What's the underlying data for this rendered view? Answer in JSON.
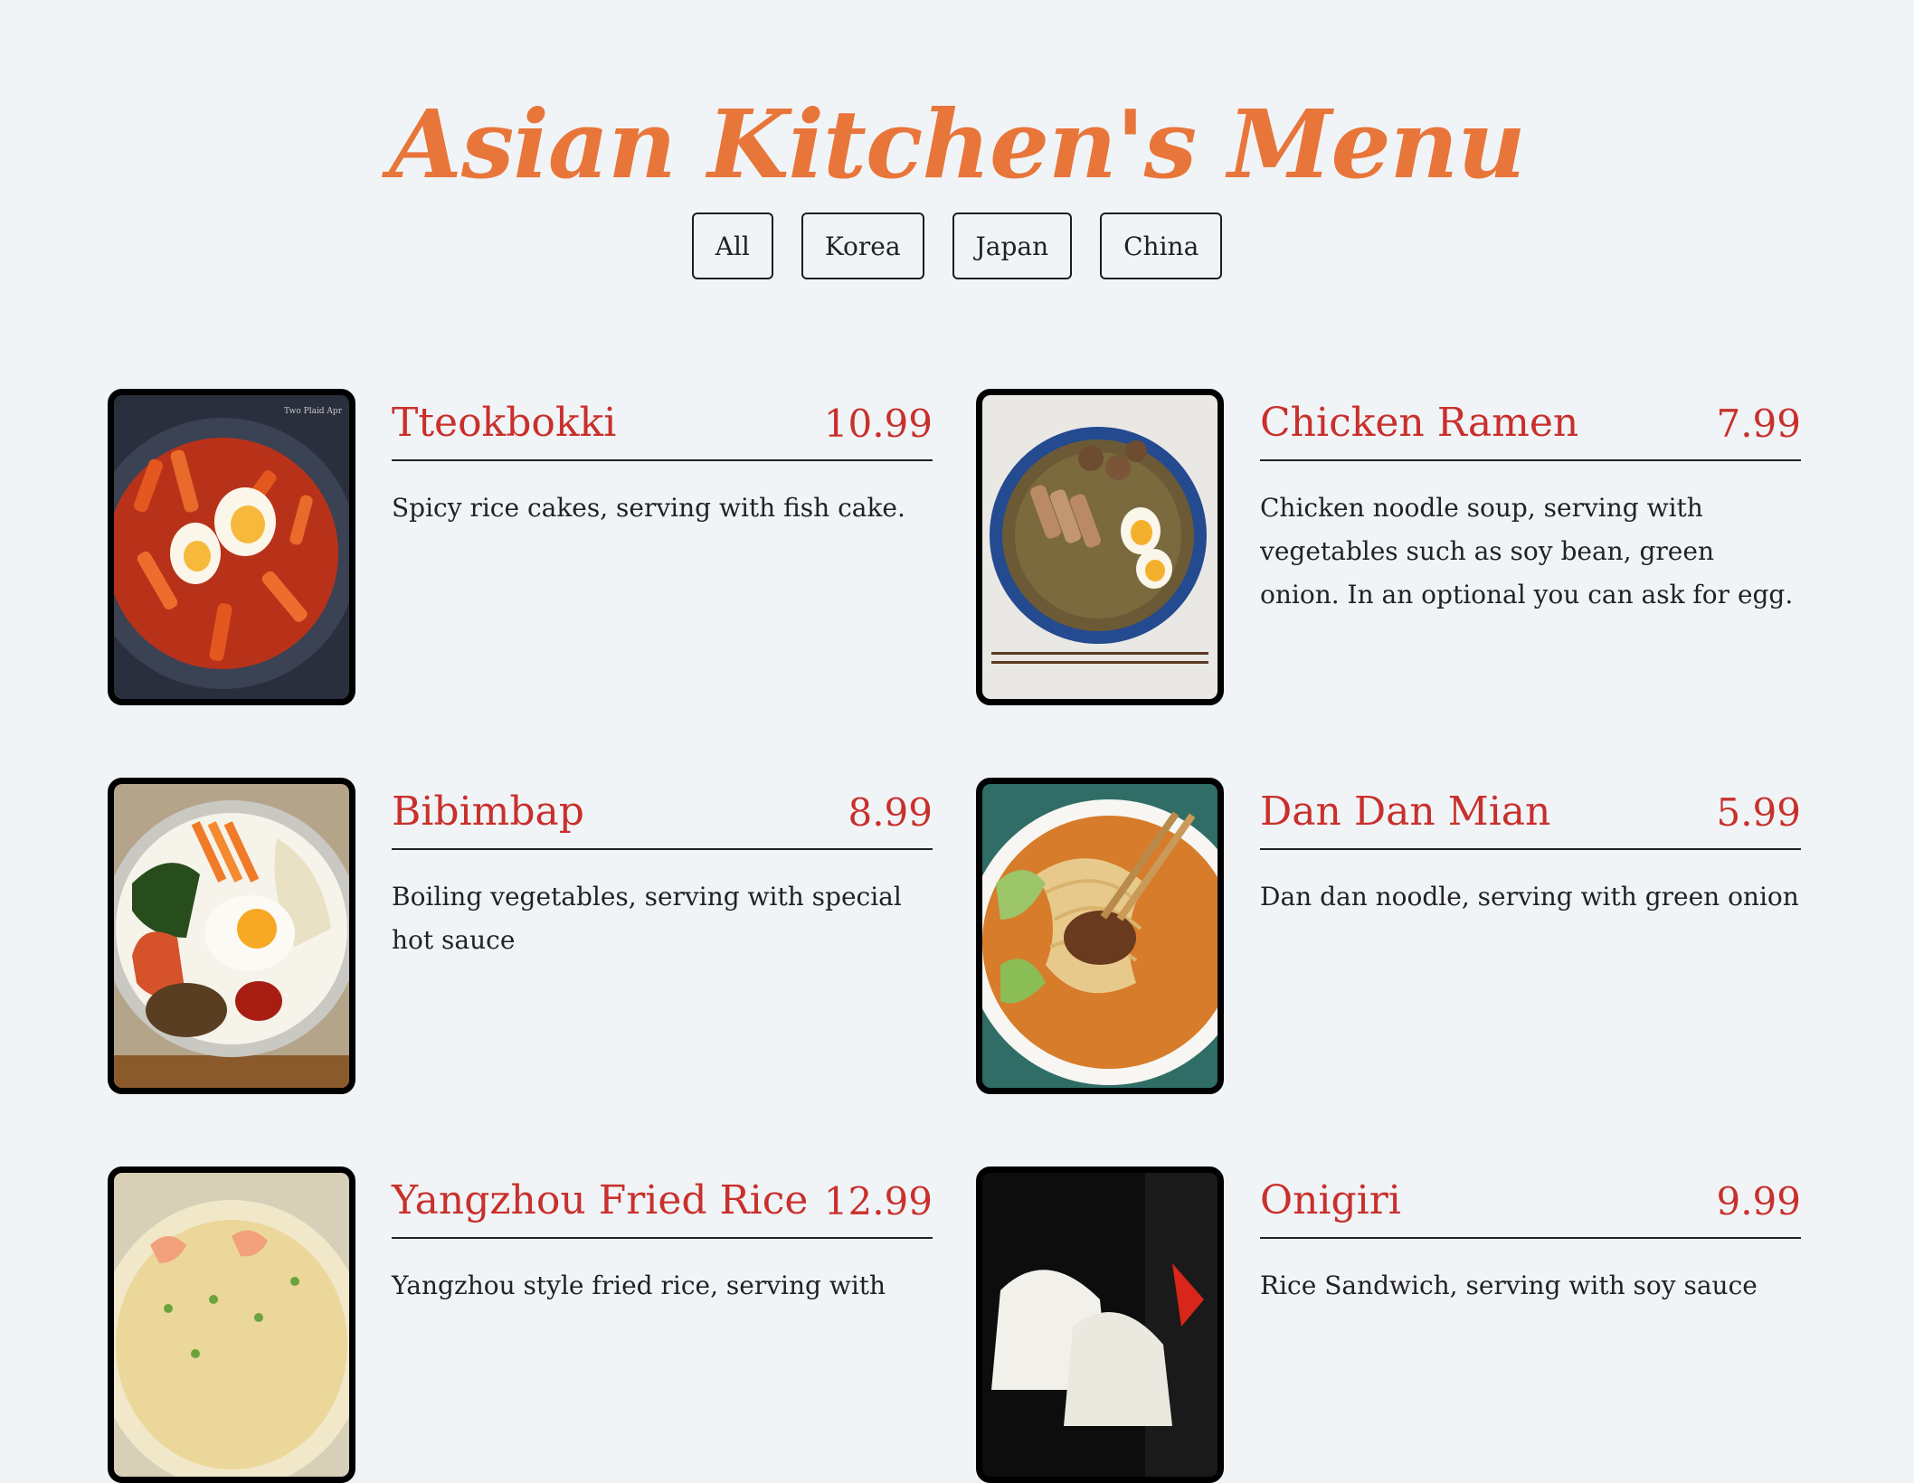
{
  "header": {
    "title": "Asian Kitchen's Menu"
  },
  "filters": [
    {
      "label": "All"
    },
    {
      "label": "Korea"
    },
    {
      "label": "Japan"
    },
    {
      "label": "China"
    }
  ],
  "menu": [
    {
      "name": "Tteokbokki",
      "price": "10.99",
      "description": "Spicy rice cakes, serving with fish cake.",
      "image_watermark": "Two Plaid Apr"
    },
    {
      "name": "Chicken Ramen",
      "price": "7.99",
      "description": "Chicken noodle soup, serving with vegetables such as soy bean, green onion. In an optional you can ask for egg."
    },
    {
      "name": "Bibimbap",
      "price": "8.99",
      "description": "Boiling vegetables, serving with special hot sauce"
    },
    {
      "name": "Dan Dan Mian",
      "price": "5.99",
      "description": "Dan dan noodle, serving with green onion"
    },
    {
      "name": "Yangzhou Fried Rice",
      "price": "12.99",
      "description": "Yangzhou style fried rice, serving with"
    },
    {
      "name": "Onigiri",
      "price": "9.99",
      "description": "Rice Sandwich, serving with soy sauce"
    }
  ],
  "colors": {
    "background": "#f1f4f7",
    "title": "#e8763a",
    "accent": "#c9302c",
    "text": "#222222"
  }
}
